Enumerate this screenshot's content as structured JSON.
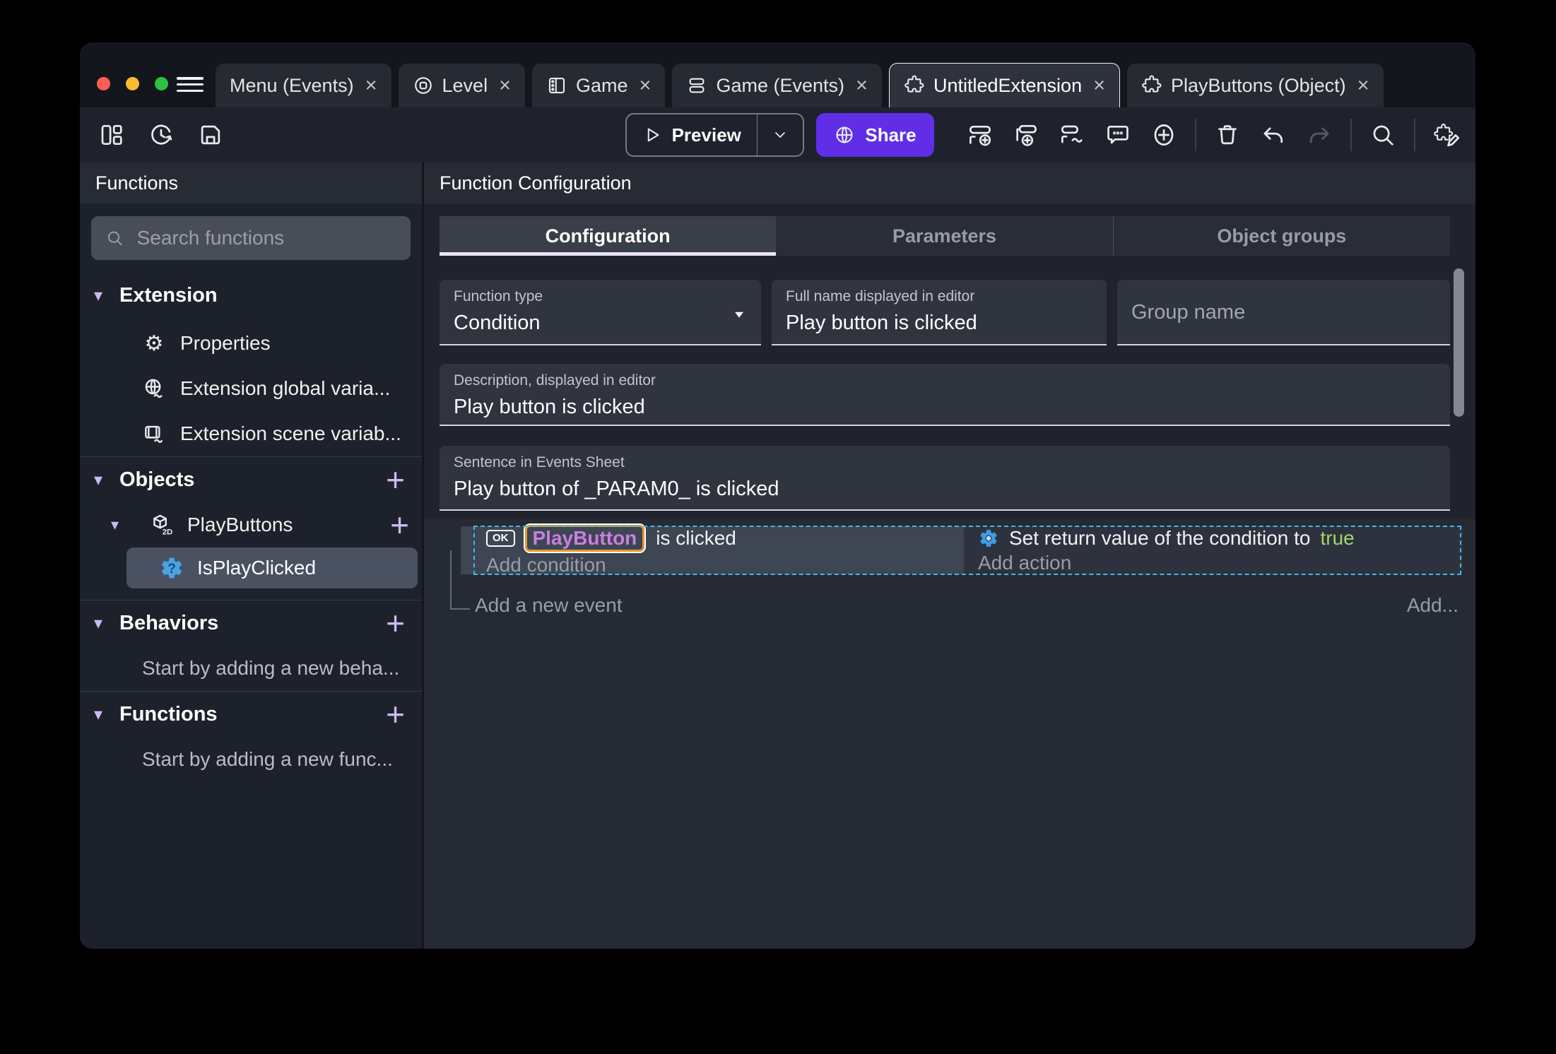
{
  "titlebar": {
    "close_glyph": "×",
    "tabs": [
      {
        "label": "Menu (Events)"
      },
      {
        "label": "Level"
      },
      {
        "label": "Game"
      },
      {
        "label": "Game (Events)"
      },
      {
        "label": "UntitledExtension"
      },
      {
        "label": "PlayButtons (Object)"
      }
    ]
  },
  "toolbar": {
    "preview_label": "Preview",
    "share_label": "Share"
  },
  "sidebar": {
    "title": "Functions",
    "search_placeholder": "Search functions",
    "extension_header": "Extension",
    "properties": "Properties",
    "global_vars": "Extension global varia...",
    "scene_vars": "Extension scene variab...",
    "objects_header": "Objects",
    "playbuttons": "PlayButtons",
    "isplayclicked": "IsPlayClicked",
    "behaviors_header": "Behaviors",
    "behaviors_note": "Start by adding a new beha...",
    "functions_header": "Functions",
    "functions_note": "Start by adding a new func...",
    "add_glyph": "+",
    "collapse_glyph": "▾"
  },
  "main": {
    "title": "Function Configuration",
    "tab_configuration": "Configuration",
    "tab_parameters": "Parameters",
    "tab_object_groups": "Object groups",
    "function_type_label": "Function type",
    "function_type_value": "Condition",
    "full_name_label": "Full name displayed in editor",
    "full_name_value": "Play button is clicked",
    "group_name_placeholder": "Group name",
    "description_label": "Description, displayed in editor",
    "description_value": "Play button is clicked",
    "sentence_label": "Sentence in Events Sheet",
    "sentence_value": "Play button of _PARAM0_ is clicked"
  },
  "events": {
    "ok_badge": "OK",
    "condition_object": "PlayButton",
    "condition_suffix": "is clicked",
    "add_condition": "Add condition",
    "action_prefix": "Set return value of the condition to",
    "action_value": "true",
    "add_action": "Add action",
    "add_new_event": "Add a new event",
    "add_button": "Add..."
  },
  "colors": {
    "accent_purple": "#5f2ee6",
    "lavender": "#cdb9f1",
    "selection_blue": "#49b3e8",
    "object_text_purple": "#c77fe0",
    "object_border_orange": "#e39b2d",
    "true_green": "#a5d46a",
    "icon_blue": "#4aa2e2"
  }
}
